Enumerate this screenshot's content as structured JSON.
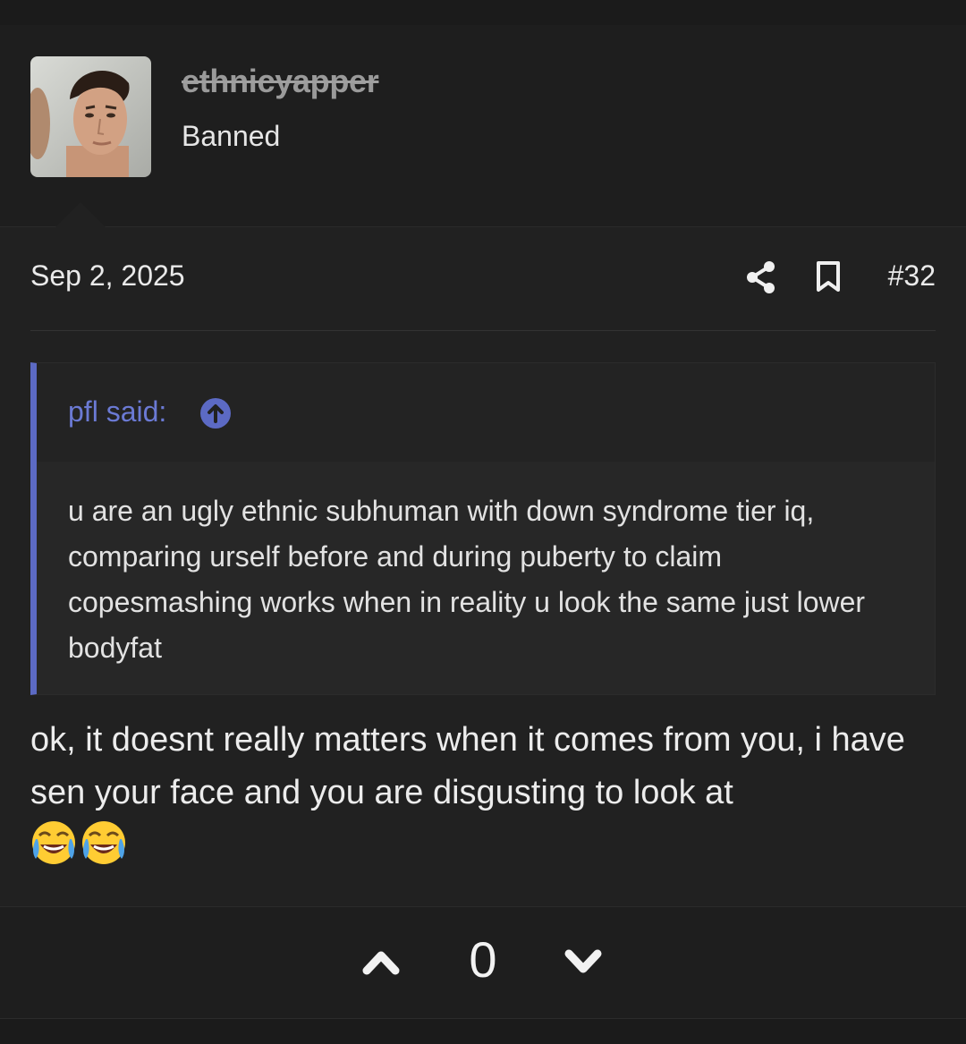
{
  "post": {
    "username": "ethnicyapper",
    "user_title": "Banned",
    "date": "Sep 2, 2025",
    "post_number": "#32",
    "quote": {
      "author": "pfl said:",
      "text": "u are an ugly ethnic subhuman with down syndrome tier iq, comparing urself before and during puberty to claim copesmashing works when in reality u look the same just lower bodyfat"
    },
    "message": "ok, it doesnt really matters when it comes from you, i have sen your face and you are disgusting to look at",
    "emojis": [
      "face-with-tears-of-joy-icon",
      "face-with-tears-of-joy-icon"
    ],
    "score": "0"
  },
  "icons": {
    "share": "share-icon",
    "bookmark": "bookmark-icon",
    "quote_jump": "arrow-up-circle-icon",
    "upvote": "chevron-up-icon",
    "downvote": "chevron-down-icon"
  },
  "colors": {
    "accent": "#5c6ac4",
    "quote_author": "#6b7ad4",
    "background": "#212121"
  }
}
